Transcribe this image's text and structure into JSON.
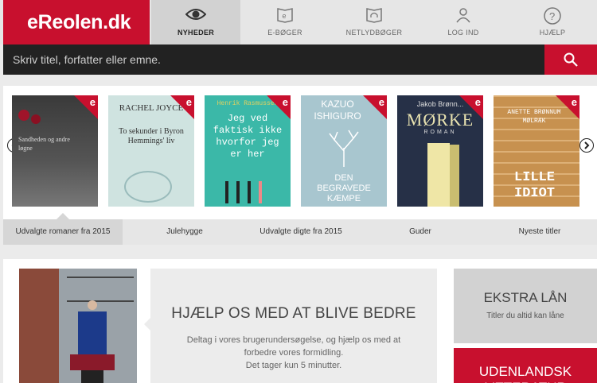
{
  "logo": {
    "text": "eReolen.dk"
  },
  "nav": [
    {
      "label": "NYHEDER",
      "icon": "eye-icon"
    },
    {
      "label": "E-BØGER",
      "icon": "ebook-icon"
    },
    {
      "label": "NETLYDBØGER",
      "icon": "audiobook-icon"
    },
    {
      "label": "LOG IND",
      "icon": "user-icon"
    },
    {
      "label": "HJÆLP",
      "icon": "help-icon"
    }
  ],
  "search": {
    "placeholder": "Skriv titel, forfatter eller emne.",
    "value": ""
  },
  "books": [
    {
      "author": "",
      "title": "Sandheden og andre løgne",
      "badge": "e"
    },
    {
      "author": "RACHEL JOYCE",
      "title": "To sekunder i Byron Hemmings' liv",
      "badge": "e"
    },
    {
      "author": "Henrik Rasmussen",
      "title": "Jeg ved faktisk ikke hvorfor jeg er her",
      "badge": "e"
    },
    {
      "author": "KAZUO ISHIGURO",
      "title": "DEN BEGRAVEDE KÆMPE",
      "badge": "e"
    },
    {
      "author": "Jakob Brønn...",
      "title": "MØRKE",
      "subtitle": "ROMAN",
      "badge": "e"
    },
    {
      "author": "ANETTE BRØNNUM MØLRÆK",
      "title": "LILLE IDIOT",
      "badge": "e"
    }
  ],
  "categories": [
    "Udvalgte romaner fra 2015",
    "Julehygge",
    "Udvalgte digte fra 2015",
    "Guder",
    "Nyeste titler"
  ],
  "promo": {
    "title": "HJÆLP OS MED AT BLIVE BEDRE",
    "text_line1": "Deltag i vores brugerundersøgelse, og hjælp os med at forbedre vores formidling.",
    "text_line2": "Det tager kun 5 minutter."
  },
  "side": {
    "extra_title": "EKSTRA LÅN",
    "extra_sub": "Titler du altid kan låne",
    "foreign_title": "UDENLANDSK LITTERATUR"
  },
  "colors": {
    "brand": "#c8102e",
    "dark": "#222222"
  }
}
